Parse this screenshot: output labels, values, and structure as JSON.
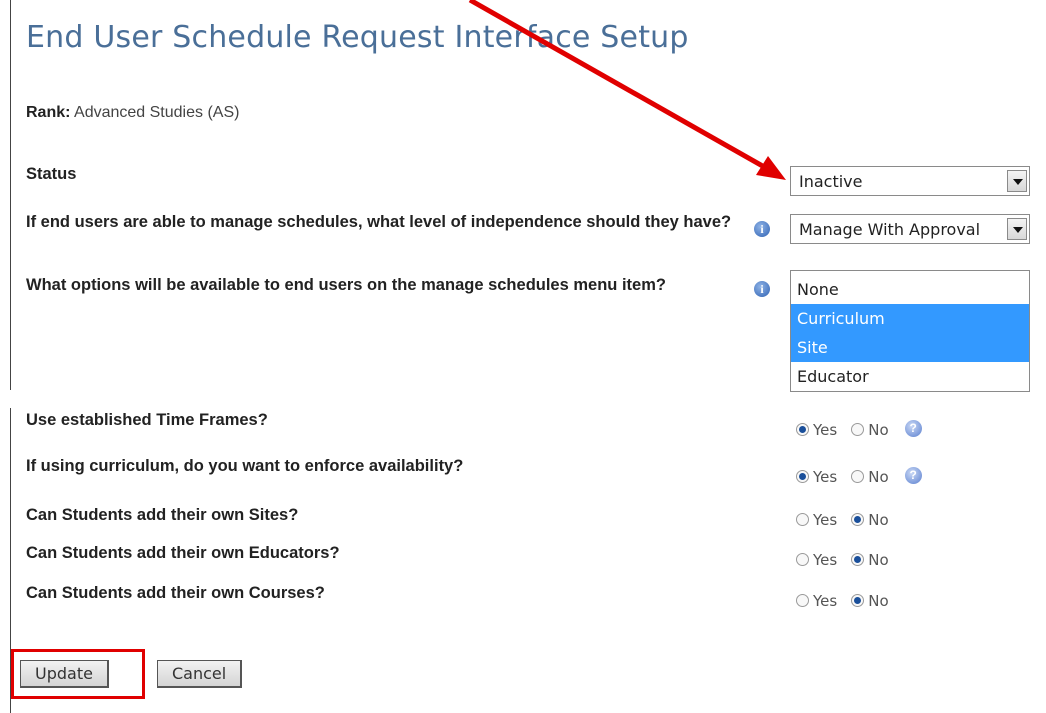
{
  "page": {
    "title": "End User Schedule Request Interface Setup"
  },
  "rank": {
    "label": "Rank:",
    "value": "Advanced Studies (AS)"
  },
  "status": {
    "label": "Status",
    "selected": "Inactive"
  },
  "independence": {
    "label": "If end users are able to manage schedules, what level of independence should they have?",
    "selected": "Manage With Approval"
  },
  "menu_options": {
    "label": "What options will be available to end users on the manage schedules menu item?",
    "options": [
      {
        "label": "None",
        "selected": false
      },
      {
        "label": "Curriculum",
        "selected": true
      },
      {
        "label": "Site",
        "selected": true
      },
      {
        "label": "Educator",
        "selected": false
      }
    ]
  },
  "questions": [
    {
      "label": "Use established Time Frames?",
      "yes": "Yes",
      "no": "No",
      "value": "yes",
      "help": true
    },
    {
      "label": "If using curriculum, do you want to enforce availability?",
      "yes": "Yes",
      "no": "No",
      "value": "yes",
      "help": true
    },
    {
      "label": "Can Students add their own Sites?",
      "yes": "Yes",
      "no": "No",
      "value": "no",
      "help": false
    },
    {
      "label": "Can Students add their own Educators?",
      "yes": "Yes",
      "no": "No",
      "value": "no",
      "help": false
    },
    {
      "label": "Can Students add their own Courses?",
      "yes": "Yes",
      "no": "No",
      "value": "no",
      "help": false
    }
  ],
  "buttons": {
    "update": "Update",
    "cancel": "Cancel"
  },
  "icons": {
    "info": "i",
    "help": "?"
  },
  "colors": {
    "title": "#4a6f98",
    "selection": "#3399ff",
    "annotation": "#e00000"
  }
}
